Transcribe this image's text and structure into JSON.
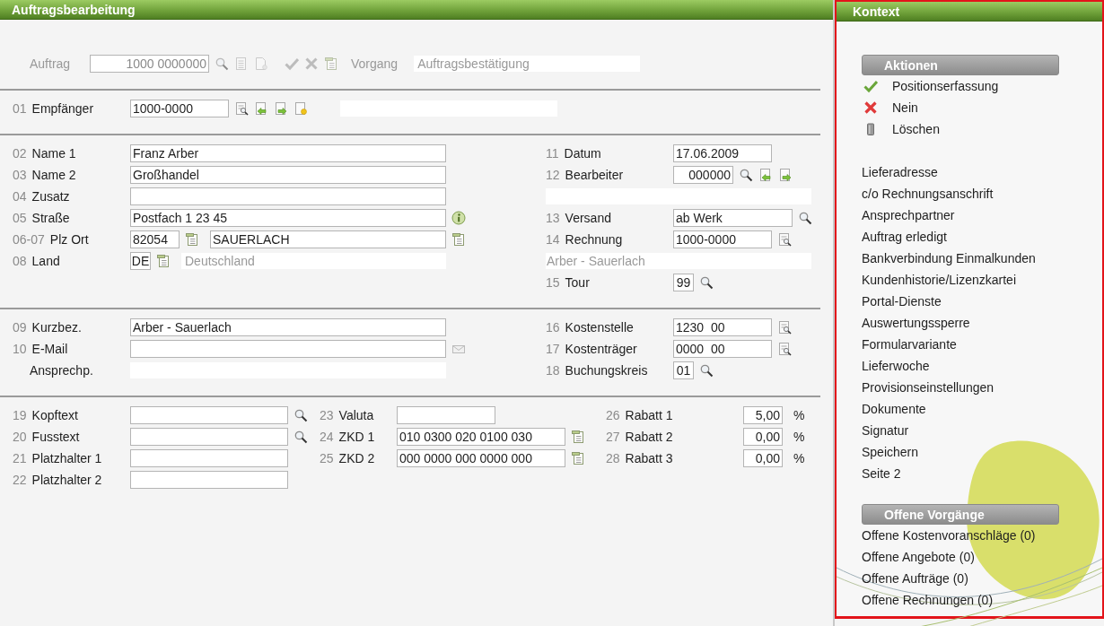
{
  "header": {
    "title": "Auftragsbearbeitung"
  },
  "form": {
    "sections": [
      {
        "disabled": true,
        "columns": [
          {
            "rows": [
              {
                "kind": "field",
                "label": "Auftrag",
                "controls": [
                  {
                    "kind": "numfield",
                    "value": "1000 0000000"
                  },
                  {
                    "kind": "search"
                  },
                  {
                    "kind": "sheet"
                  },
                  {
                    "kind": "page"
                  },
                  {
                    "kind": "check"
                  },
                  {
                    "kind": "cross"
                  },
                  {
                    "kind": "form"
                  },
                  {
                    "kind": "label",
                    "text": "Vorgang"
                  },
                  {
                    "kind": "display",
                    "value": "Auftragsbestätigung"
                  }
                ]
              }
            ]
          }
        ]
      },
      {
        "disabled": false,
        "columns": [
          {
            "rows": [
              {
                "kind": "field",
                "num": "01",
                "label": "Empfänger",
                "controls": [
                  {
                    "kind": "field",
                    "value": "1000-0000"
                  },
                  {
                    "kind": "listsearch"
                  },
                  {
                    "kind": "import"
                  },
                  {
                    "kind": "export"
                  },
                  {
                    "kind": "newdoc"
                  },
                  {
                    "kind": "display"
                  }
                ]
              }
            ]
          }
        ]
      },
      {
        "disabled": false,
        "columns": [
          {
            "rows": [
              {
                "kind": "field",
                "num": "02",
                "label": "Name 1",
                "controls": [
                  {
                    "kind": "fill",
                    "value": "Franz Arber"
                  }
                ]
              },
              {
                "kind": "field",
                "num": "03",
                "label": "Name 2",
                "controls": [
                  {
                    "kind": "fill",
                    "value": "Großhandel"
                  }
                ]
              },
              {
                "kind": "field",
                "num": "04",
                "label": "Zusatz",
                "controls": [
                  {
                    "kind": "fill"
                  }
                ]
              },
              {
                "kind": "field",
                "num": "05",
                "label": "Straße",
                "controls": [
                  {
                    "kind": "fill",
                    "value": "Postfach 1 23 45"
                  },
                  {
                    "kind": "info"
                  }
                ]
              },
              {
                "kind": "field",
                "num": "06-07",
                "label": "Plz Ort",
                "controls": [
                  {
                    "kind": "short",
                    "value": "82054"
                  },
                  {
                    "kind": "form"
                  },
                  {
                    "kind": "fill",
                    "value": "SAUERLACH"
                  },
                  {
                    "kind": "form"
                  }
                ]
              },
              {
                "kind": "field",
                "num": "08",
                "label": "Land",
                "controls": [
                  {
                    "kind": "tiny",
                    "value": "DE"
                  },
                  {
                    "kind": "form"
                  },
                  {
                    "kind": "display",
                    "value": "Deutschland"
                  }
                ]
              }
            ]
          },
          {
            "rows": [
              {
                "kind": "field",
                "num": "11",
                "label": "Datum",
                "controls": [
                  {
                    "kind": "field",
                    "value": "17.06.2009"
                  }
                ]
              },
              {
                "kind": "field",
                "num": "12",
                "label": "Bearbeiter",
                "controls": [
                  {
                    "kind": "numfield",
                    "value": "000000"
                  },
                  {
                    "kind": "search"
                  },
                  {
                    "kind": "import"
                  },
                  {
                    "kind": "export"
                  }
                ]
              },
              {
                "kind": "band"
              },
              {
                "kind": "field",
                "num": "13",
                "label": "Versand",
                "controls": [
                  {
                    "kind": "wide",
                    "value": "ab Werk"
                  },
                  {
                    "kind": "search"
                  }
                ]
              },
              {
                "kind": "field",
                "num": "14",
                "label": "Rechnung",
                "controls": [
                  {
                    "kind": "field",
                    "value": "1000-0000"
                  },
                  {
                    "kind": "listsearch"
                  }
                ]
              },
              {
                "kind": "band",
                "value": "Arber - Sauerlach"
              },
              {
                "kind": "field",
                "num": "15",
                "label": "Tour",
                "controls": [
                  {
                    "kind": "tiny",
                    "value": "99"
                  },
                  {
                    "kind": "search"
                  }
                ]
              }
            ]
          }
        ]
      },
      {
        "disabled": false,
        "columns": [
          {
            "rows": [
              {
                "kind": "field",
                "num": "09",
                "label": "Kurzbez.",
                "controls": [
                  {
                    "kind": "fill",
                    "value": "Arber - Sauerlach"
                  }
                ]
              },
              {
                "kind": "field",
                "num": "10",
                "label": "E-Mail",
                "controls": [
                  {
                    "kind": "fill"
                  },
                  {
                    "kind": "mail"
                  }
                ]
              },
              {
                "kind": "field",
                "label": "Ansprechp.",
                "controls": [
                  {
                    "kind": "display"
                  }
                ]
              }
            ]
          },
          {
            "rows": [
              {
                "kind": "field",
                "num": "16",
                "label": "Kostenstelle",
                "controls": [
                  {
                    "kind": "field",
                    "value": "1230  00"
                  },
                  {
                    "kind": "listsearch"
                  }
                ]
              },
              {
                "kind": "field",
                "num": "17",
                "label": "Kostenträger",
                "controls": [
                  {
                    "kind": "field",
                    "value": "0000  00"
                  },
                  {
                    "kind": "listsearch"
                  }
                ]
              },
              {
                "kind": "field",
                "num": "18",
                "label": "Buchungskreis",
                "controls": [
                  {
                    "kind": "tiny",
                    "value": "01"
                  },
                  {
                    "kind": "search"
                  }
                ]
              }
            ]
          }
        ]
      },
      {
        "disabled": false,
        "columns": [
          {
            "rows": [
              {
                "kind": "field",
                "num": "19",
                "label": "Kopftext",
                "controls": [
                  {
                    "kind": "fill"
                  },
                  {
                    "kind": "search"
                  }
                ]
              },
              {
                "kind": "field",
                "num": "20",
                "label": "Fusstext",
                "controls": [
                  {
                    "kind": "fill"
                  },
                  {
                    "kind": "search"
                  }
                ]
              },
              {
                "kind": "field",
                "num": "21",
                "label": "Platzhalter 1",
                "controls": [
                  {
                    "kind": "fill"
                  }
                ]
              },
              {
                "kind": "field",
                "num": "22",
                "label": "Platzhalter 2",
                "controls": [
                  {
                    "kind": "fill"
                  }
                ]
              }
            ]
          },
          {
            "rows": [
              {
                "kind": "field",
                "num": "23",
                "label": "Valuta",
                "controls": [
                  {
                    "kind": "field"
                  }
                ]
              },
              {
                "kind": "field",
                "num": "24",
                "label": "ZKD 1",
                "controls": [
                  {
                    "kind": "fill",
                    "value": "010 0300 020 0100 030"
                  },
                  {
                    "kind": "form"
                  }
                ]
              },
              {
                "kind": "field",
                "num": "25",
                "label": "ZKD 2",
                "controls": [
                  {
                    "kind": "fill",
                    "value": "000 0000 000 0000 000"
                  },
                  {
                    "kind": "form"
                  }
                ]
              }
            ]
          },
          {
            "rows": [
              {
                "kind": "field",
                "num": "26",
                "label": "Rabatt 1",
                "controls": [
                  {
                    "kind": "numfield",
                    "value": "5,00"
                  },
                  {
                    "kind": "label",
                    "text": "%"
                  }
                ]
              },
              {
                "kind": "field",
                "num": "27",
                "label": "Rabatt 2",
                "controls": [
                  {
                    "kind": "numfield",
                    "value": "0,00"
                  },
                  {
                    "kind": "label",
                    "text": "%"
                  }
                ]
              },
              {
                "kind": "field",
                "num": "28",
                "label": "Rabatt 3",
                "controls": [
                  {
                    "kind": "numfield",
                    "value": "0,00"
                  },
                  {
                    "kind": "label",
                    "text": "%"
                  }
                ]
              }
            ]
          }
        ]
      }
    ]
  },
  "context": {
    "title": "Kontext",
    "groups": [
      {
        "title": "Aktionen",
        "items": [
          {
            "kind": "confirm",
            "label": "Positionserfassung"
          },
          {
            "kind": "reject",
            "label": "Nein"
          },
          {
            "kind": "delete",
            "label": "Löschen"
          }
        ]
      },
      {
        "items": [
          {
            "kind": "link",
            "label": "Lieferadresse"
          },
          {
            "kind": "link",
            "label": "c/o Rechnungsanschrift"
          },
          {
            "kind": "link",
            "label": "Ansprechpartner"
          },
          {
            "kind": "link",
            "label": "Auftrag erledigt"
          },
          {
            "kind": "link",
            "label": "Bankverbindung Einmalkunden"
          },
          {
            "kind": "link",
            "label": "Kundenhistorie/Lizenzkartei"
          },
          {
            "kind": "link",
            "label": "Portal-Dienste"
          },
          {
            "kind": "link",
            "label": "Auswertungssperre"
          },
          {
            "kind": "link",
            "label": "Formularvariante"
          },
          {
            "kind": "link",
            "label": "Lieferwoche"
          },
          {
            "kind": "link",
            "label": "Provisionseinstellungen"
          },
          {
            "kind": "link",
            "label": "Dokumente"
          },
          {
            "kind": "link",
            "label": "Signatur"
          },
          {
            "kind": "link",
            "label": "Speichern"
          },
          {
            "kind": "link",
            "label": "Seite 2"
          }
        ]
      },
      {
        "title": "Offene Vorgänge",
        "items": [
          {
            "kind": "link",
            "label": "Offene Kostenvoranschläge (0)"
          },
          {
            "kind": "link",
            "label": "Offene Angebote (0)"
          },
          {
            "kind": "link",
            "label": "Offene Aufträge (0)"
          },
          {
            "kind": "link",
            "label": "Offene Rechnungen (0)"
          }
        ]
      }
    ]
  }
}
